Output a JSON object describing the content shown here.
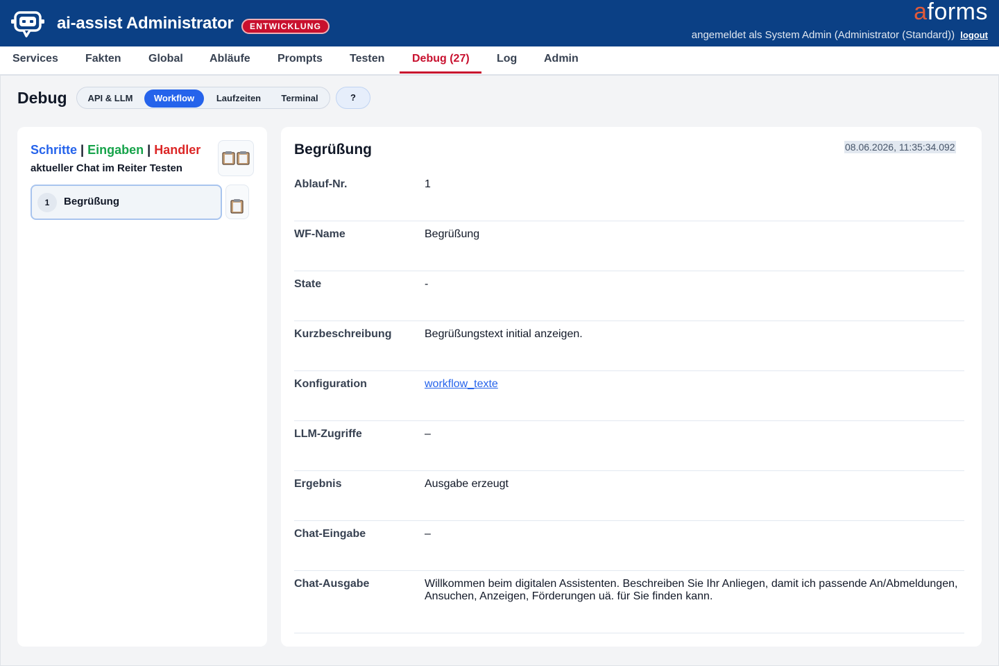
{
  "header": {
    "app_title": "ai-assist Administrator",
    "env_badge": "ENTWICKLUNG",
    "brand_a": "a",
    "brand_rest": "forms",
    "user_text": "angemeldet als System Admin (Administrator (Standard))",
    "logout_label": "logout",
    "logo_icon": "robot-chat-icon"
  },
  "nav": {
    "items": [
      "Services",
      "Fakten",
      "Global",
      "Abläufe",
      "Prompts",
      "Testen",
      "Debug (27)",
      "Log",
      "Admin"
    ],
    "active": "Debug (27)"
  },
  "debug": {
    "page_title": "Debug",
    "tabs": [
      "API & LLM",
      "Workflow",
      "Laufzeiten",
      "Terminal"
    ],
    "active_tab": "Workflow",
    "help_label": "?"
  },
  "left": {
    "heading_steps": "Schritte",
    "sep": "|",
    "heading_inputs": "Eingaben",
    "heading_handler": "Handler",
    "subtitle": "aktueller Chat im Reiter Testen",
    "copy_all_icon": "clipboard-double-icon",
    "step": {
      "number": "1",
      "label": "Begrüßung"
    },
    "copy_step_icon": "clipboard-icon"
  },
  "detail": {
    "title": "Begrüßung",
    "timestamp": "08.06.2026, 11:35:34.092",
    "rows": [
      {
        "key": "Ablauf-Nr.",
        "value": "1"
      },
      {
        "key": "WF-Name",
        "value": "Begrüßung"
      },
      {
        "key": "State",
        "value": "-"
      },
      {
        "key": "Kurzbeschreibung",
        "value": "Begrüßungstext initial anzeigen."
      },
      {
        "key": "Konfiguration",
        "value": "workflow_texte"
      },
      {
        "key": "LLM-Zugriffe",
        "value": "–"
      },
      {
        "key": "Ergebnis",
        "value": "Ausgabe erzeugt"
      },
      {
        "key": "Chat-Eingabe",
        "value": "–"
      },
      {
        "key": "Chat-Ausgabe",
        "value": "Willkommen beim digitalen Assistenten. Beschreiben Sie Ihr Anliegen, damit ich passende An/Abmeldungen, Ansuchen, Anzeigen, Förderungen uä. für Sie finden kann."
      }
    ]
  },
  "colors": {
    "header_bg": "#0b4085",
    "accent_red": "#c8102e",
    "accent_blue": "#2563eb",
    "green": "#16a34a"
  }
}
